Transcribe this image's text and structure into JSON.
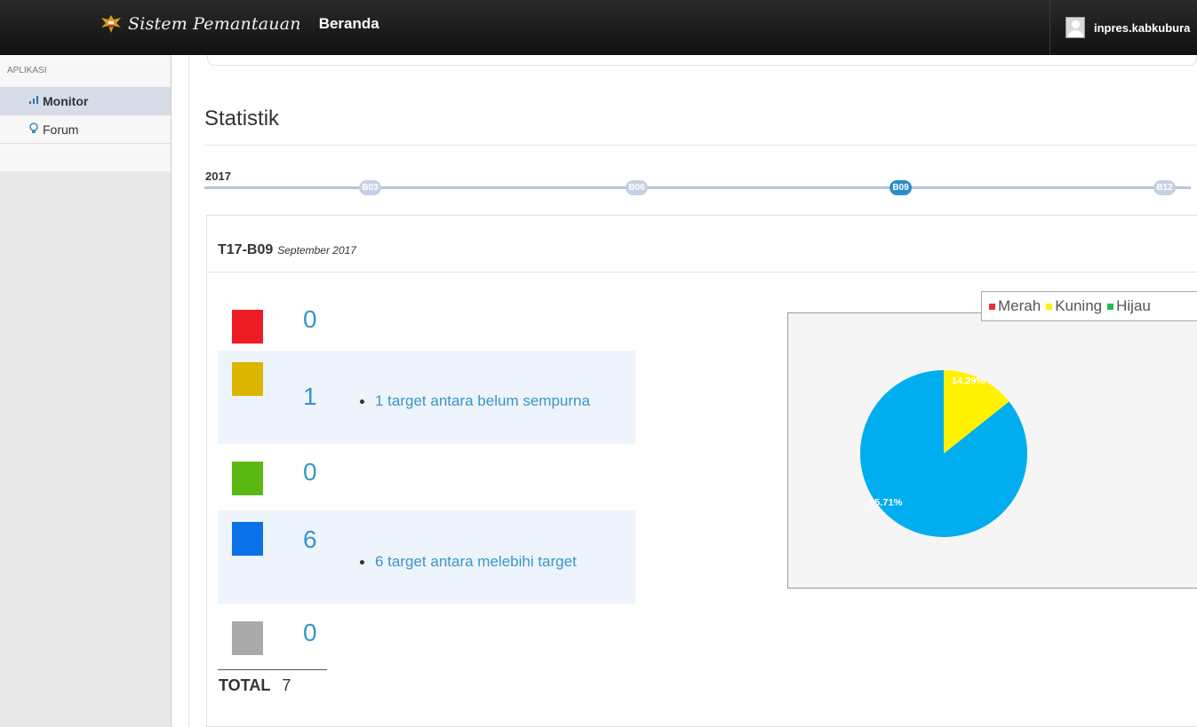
{
  "header": {
    "brand_script": "Sistem Pemantauan",
    "page_name": "Beranda",
    "username": "inpres.kabkubura"
  },
  "sidebar": {
    "heading": "APLIKASI",
    "items": [
      {
        "label": "Monitor",
        "icon": "bar-chart-icon",
        "active": true
      },
      {
        "label": "Forum",
        "icon": "lightbulb-icon",
        "active": false
      }
    ]
  },
  "main": {
    "title": "Statistik",
    "timeline": {
      "year": "2017",
      "nodes": [
        "B03",
        "B06",
        "B09",
        "B12"
      ],
      "active": "B09"
    },
    "period": {
      "code": "T17-B09",
      "date": "September 2017"
    },
    "stats": [
      {
        "color": "#ee1c25",
        "count": "0",
        "note": ""
      },
      {
        "color": "#dbb600",
        "count": "1",
        "note": "1 target antara belum sempurna"
      },
      {
        "color": "#5cb813",
        "count": "0",
        "note": ""
      },
      {
        "color": "#0a71e8",
        "count": "6",
        "note": "6 target antara melebihi target"
      },
      {
        "color": "#aaaaaa",
        "count": "0",
        "note": ""
      }
    ],
    "total": {
      "label": "TOTAL",
      "value": "7"
    }
  },
  "chart_data": {
    "type": "pie",
    "legend": [
      {
        "name": "Merah",
        "color": "#e53040"
      },
      {
        "name": "Kuning",
        "color": "#fff200"
      },
      {
        "name": "Hijau",
        "color": "#2bb55a"
      }
    ],
    "slices": [
      {
        "value": 14.29,
        "label": "14.29%",
        "color": "#fff200"
      },
      {
        "value": 85.71,
        "label": "85.71%",
        "color": "#00aeef"
      }
    ],
    "legend_placement": "top-right"
  }
}
